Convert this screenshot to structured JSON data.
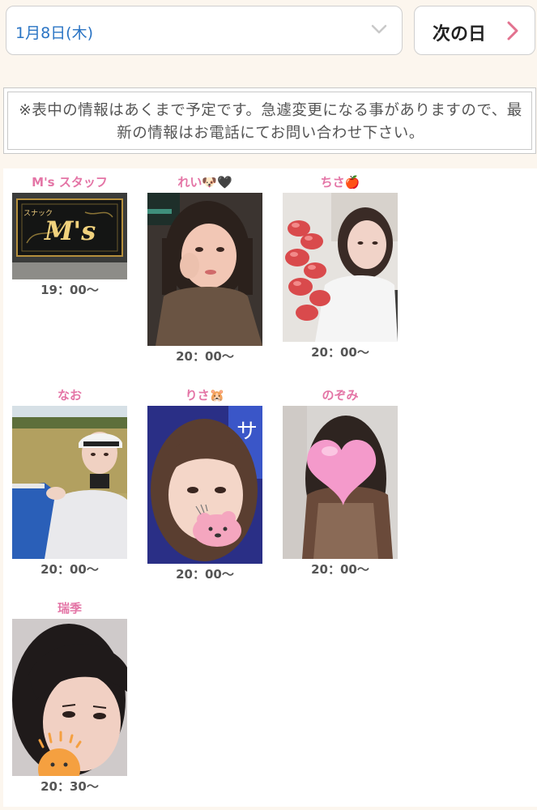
{
  "date_select": {
    "value": "1月8日(木)",
    "icon": "chevron-down-icon"
  },
  "next_button": {
    "label": "次の日",
    "icon": "chevron-right-icon",
    "accent": "#e2728f"
  },
  "notice": {
    "text": "※表中の情報はあくまで予定です。急遽変更になる事がありますので、最新の情報はお電話にてお問い合わせ下さい。"
  },
  "casts": [
    {
      "name": "M's スタッフ",
      "time": "19：00〜",
      "photo_sign": "M's"
    },
    {
      "name": "れい🐶🖤",
      "time": "20：00〜"
    },
    {
      "name": "ちさ🍎",
      "time": "20：00〜"
    },
    {
      "name": "なお",
      "time": "20：00〜"
    },
    {
      "name": "りさ🐹",
      "time": "20：00〜"
    },
    {
      "name": "のぞみ",
      "time": "20：00〜"
    },
    {
      "name": "瑞季",
      "time": "20：30〜"
    }
  ],
  "colors": {
    "name_pink": "#e475a6",
    "date_blue": "#2a74c4",
    "page_bg": "#fcf6ee"
  }
}
